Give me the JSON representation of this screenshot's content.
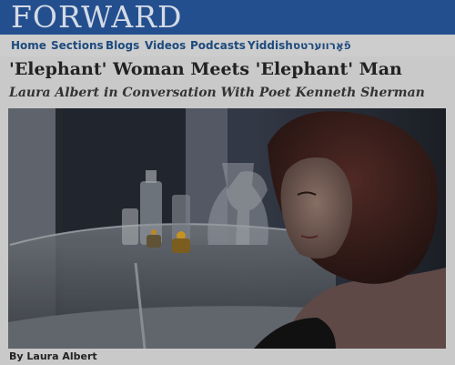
{
  "site": {
    "logo": "FORWARD"
  },
  "nav": {
    "items": [
      {
        "label": "Home"
      },
      {
        "label": "Sections"
      },
      {
        "label": "Blogs"
      },
      {
        "label": "Videos"
      },
      {
        "label": "Podcasts"
      },
      {
        "label": "Yiddish"
      },
      {
        "label": "פֿאָרווערטס"
      }
    ]
  },
  "article": {
    "headline": "'Elephant' Woman Meets 'Elephant' Man",
    "subhead": "Laura Albert in Conversation With Poet Kenneth Sherman",
    "byline": "By Laura Albert"
  },
  "colors": {
    "masthead": "#244f8e",
    "nav_link": "#1d4a7e",
    "page_bg": "#c9c9c9"
  }
}
